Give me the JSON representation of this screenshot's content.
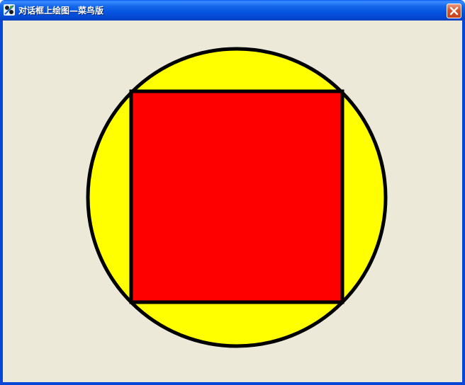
{
  "window": {
    "title": "对话框上绘图—菜鸟版",
    "icon": "app-icon",
    "close_icon": "close-icon"
  },
  "canvas": {
    "background_color": "#ece9d8",
    "shapes": [
      {
        "type": "circle",
        "fill": "#ffff00",
        "stroke": "#000000"
      },
      {
        "type": "square",
        "fill": "#ff0000",
        "stroke": "#000000"
      }
    ]
  }
}
